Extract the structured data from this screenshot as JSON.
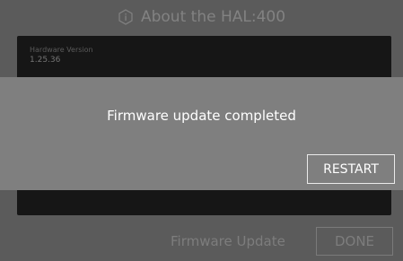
{
  "header": {
    "title": "About the HAL:400",
    "icon": "info-icon"
  },
  "info": {
    "hardware_version_label": "Hardware Version",
    "hardware_version_value": "1.25.36"
  },
  "footer": {
    "title": "Firmware Update",
    "done_label": "DONE"
  },
  "dialog": {
    "message": "Firmware update completed",
    "restart_label": "RESTART"
  },
  "colors": {
    "background": "#5b5b5b",
    "panel": "#161616",
    "dialog": "#7f7f7f",
    "dialog_text": "#ffffff"
  }
}
